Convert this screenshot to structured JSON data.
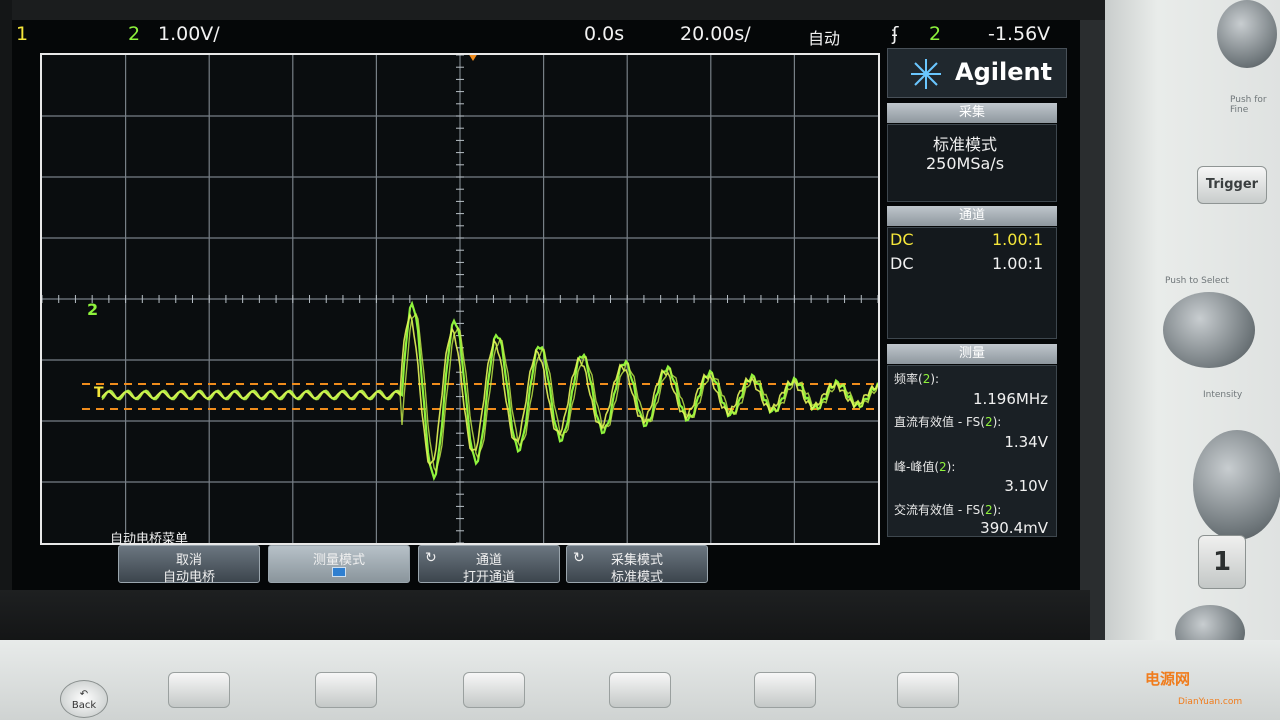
{
  "status_bar": {
    "ch1_label": "1",
    "ch2_label": "2",
    "ch2_scale": "1.00V/",
    "time_offset": "0.0s",
    "time_scale": "20.00s/",
    "trigger_mode": "自动",
    "trigger_slope_icon": "rising-edge-icon",
    "trigger_source": "2",
    "trigger_level": "-1.56V"
  },
  "brand": "Agilent",
  "acquisition": {
    "header": "采集",
    "mode": "标准模式",
    "sample_rate": "250MSa/s"
  },
  "channels": {
    "header": "通道",
    "rows": [
      {
        "coupling": "DC",
        "probe": "1.00:1"
      },
      {
        "coupling": "DC",
        "probe": "1.00:1"
      }
    ]
  },
  "measurements": {
    "header": "测量",
    "items": [
      {
        "label": "频率",
        "channel": "2",
        "value": "1.196MHz"
      },
      {
        "label": "直流有效值 - FS",
        "channel": "2",
        "value": "1.34V"
      },
      {
        "label": "峰-峰值",
        "channel": "2",
        "value": "3.10V"
      },
      {
        "label": "交流有效值 - FS",
        "channel": "2",
        "value": "390.4mV"
      }
    ]
  },
  "ground_markers": {
    "ch2": "2",
    "ch1": "T"
  },
  "softkey_menu": {
    "title": "自动电桥菜单",
    "keys": [
      {
        "line1": "取消",
        "line2": "自动电桥"
      },
      {
        "line1": "测量模式",
        "line2": ""
      },
      {
        "line1": "通道",
        "line2": "打开通道"
      },
      {
        "line1": "采集模式",
        "line2": "标准模式"
      }
    ]
  },
  "front_panel": {
    "trigger_button": "Trigger",
    "push_fine": "Push for Fine",
    "push_select": "Push to Select",
    "intensity": "Intensity",
    "channel_button": "1",
    "back_button": "Back"
  },
  "watermark": {
    "name": "电源网",
    "url": "DianYuan.com"
  },
  "colors": {
    "ch1": "#f5e63a",
    "ch2": "#8ef23c",
    "cursor": "#f08c1c",
    "grid": "#8b949b"
  }
}
